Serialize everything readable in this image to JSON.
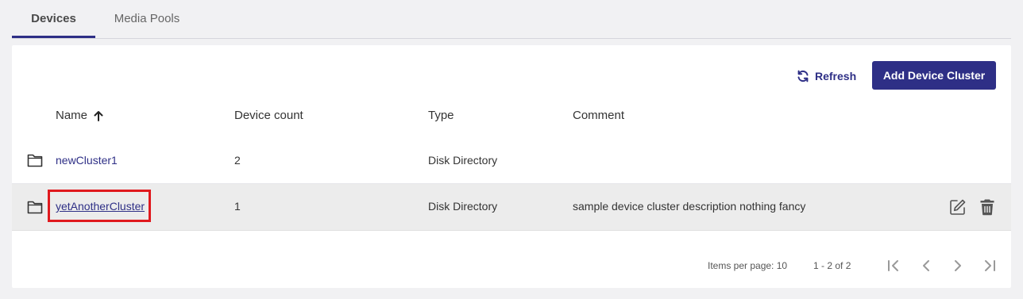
{
  "tabs": [
    {
      "label": "Devices",
      "active": true
    },
    {
      "label": "Media Pools",
      "active": false
    }
  ],
  "toolbar": {
    "refresh_label": "Refresh",
    "add_label": "Add Device Cluster"
  },
  "table": {
    "columns": [
      "Name",
      "Device count",
      "Type",
      "Comment"
    ],
    "sort": {
      "column": "Name",
      "direction": "ascending"
    },
    "rows": [
      {
        "name": "newCluster1",
        "count": "2",
        "type": "Disk Directory",
        "comment": ""
      },
      {
        "name": "yetAnotherCluster",
        "count": "1",
        "type": "Disk Directory",
        "comment": "sample device cluster description nothing fancy"
      }
    ]
  },
  "paginator": {
    "items_per_page": "Items per page: 10",
    "range": "1 - 2 of 2"
  },
  "colors": {
    "accent": "#2e2f86",
    "highlight": "#e0191e",
    "selected_row": "#ececec"
  }
}
